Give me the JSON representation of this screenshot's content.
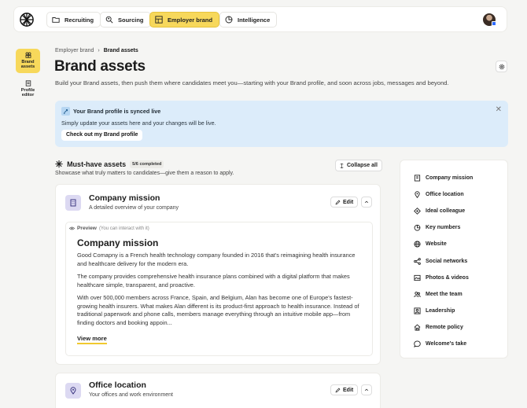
{
  "nav": {
    "tabs": [
      {
        "label": "Recruiting",
        "icon": "folder-icon"
      },
      {
        "label": "Sourcing",
        "icon": "search-person-icon"
      },
      {
        "label": "Employer brand",
        "icon": "layout-icon",
        "active": true
      },
      {
        "label": "Intelligence",
        "icon": "pie-chart-icon"
      }
    ]
  },
  "rail": {
    "items": [
      {
        "label": "Brand assets",
        "icon": "brand-assets-icon",
        "active": true
      },
      {
        "label": "Profile editor",
        "icon": "profile-editor-icon"
      }
    ]
  },
  "breadcrumb": {
    "parent": "Employer brand",
    "separator": "›",
    "current": "Brand assets"
  },
  "page": {
    "title": "Brand assets",
    "subtitle": "Build your Brand assets, then push them where candidates meet you—starting with your Brand profile, and soon across jobs, messages and beyond."
  },
  "banner": {
    "title": "Your Brand profile is synced live",
    "text": "Simply update your assets here and your changes will be live.",
    "button": "Check out my Brand profile",
    "close": "✕"
  },
  "section": {
    "star": "✳",
    "title": "Must-have assets",
    "badge": "5/6 completed",
    "description": "Showcase what truly matters to candidates—give them a reason to apply.",
    "collapse_label": "Collapse all"
  },
  "cards": [
    {
      "title": "Company mission",
      "subtitle": "A detailed overview of your company",
      "edit_label": "Edit",
      "preview_label": "Preview",
      "preview_hint": "(You can interact with it)",
      "preview_title": "Company mission",
      "paragraphs": [
        "Good Comapny is a French health technology company founded in 2016 that's reimagining health insurance and healthcare delivery for the modern era.",
        "The company provides comprehensive health insurance plans combined with a digital platform that makes healthcare simple, transparent, and proactive.",
        "With over 500,000 members across France, Spain, and Belgium, Alan has become one of Europe's fastest-growing health insurers. What makes Alan different is its product-first approach to health insurance. Instead of traditional paperwork and phone calls, members manage everything through an intuitive mobile app—from finding doctors and booking appoin..."
      ],
      "view_more": "View more"
    },
    {
      "title": "Office location",
      "subtitle": "Your offices and work environment",
      "edit_label": "Edit"
    }
  ],
  "side_nav": [
    {
      "label": "Company mission",
      "icon": "building-icon"
    },
    {
      "label": "Office location",
      "icon": "location-pin-icon"
    },
    {
      "label": "Ideal colleague",
      "icon": "target-icon"
    },
    {
      "label": "Key numbers",
      "icon": "pie-chart-icon"
    },
    {
      "label": "Website",
      "icon": "globe-icon"
    },
    {
      "label": "Social networks",
      "icon": "share-icon"
    },
    {
      "label": "Photos & videos",
      "icon": "photos-icon"
    },
    {
      "label": "Meet the team",
      "icon": "team-icon"
    },
    {
      "label": "Leadership",
      "icon": "leader-icon"
    },
    {
      "label": "Remote policy",
      "icon": "home-icon"
    },
    {
      "label": "Welcome's take",
      "icon": "chat-bubble-icon"
    }
  ]
}
